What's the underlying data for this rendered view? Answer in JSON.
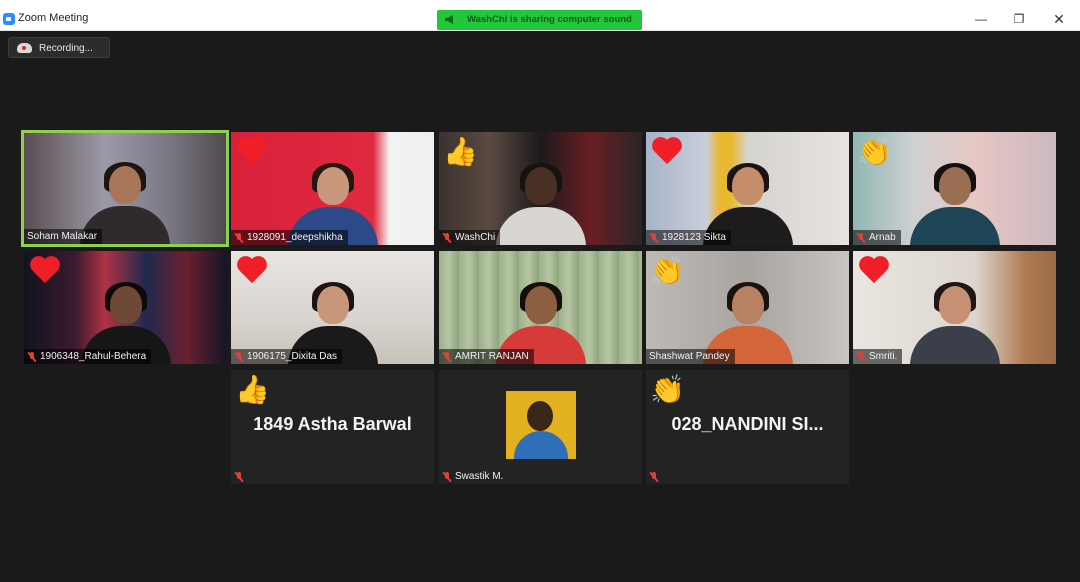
{
  "window": {
    "title": "Zoom Meeting",
    "minimize_glyph": "—",
    "maximize_glyph": "❐",
    "close_glyph": "✕"
  },
  "share_banner": {
    "text": "WashChi is sharing computer sound",
    "color": "#22c63a"
  },
  "recording": {
    "label": "Recording..."
  },
  "colors": {
    "active_speaker_border": "#8fd14f",
    "mute_icon": "#e0403a",
    "heart": "#ef1e27"
  },
  "participants": [
    {
      "name": "Soham Malakar",
      "muted": false,
      "active_speaker": true,
      "reaction": ""
    },
    {
      "name": "1928091_deepshikha",
      "muted": true,
      "reaction": "heart"
    },
    {
      "name": "WashChi",
      "muted": true,
      "reaction": "thumbs-up",
      "reaction_glyph": "👍"
    },
    {
      "name": "1928123 Sikta",
      "muted": true,
      "reaction": "heart"
    },
    {
      "name": "Arnab",
      "muted": true,
      "reaction": "clap",
      "reaction_glyph": "👏"
    },
    {
      "name": "1906348_Rahul-Behera",
      "muted": true,
      "reaction": "heart"
    },
    {
      "name": "1906175_Dixita Das",
      "muted": true,
      "reaction": "heart"
    },
    {
      "name": "AMRIT RANJAN",
      "muted": true,
      "reaction": ""
    },
    {
      "name": "Shashwat Pandey",
      "muted": false,
      "reaction": "clap",
      "reaction_glyph": "👏"
    },
    {
      "name": "Smriti.",
      "muted": true,
      "reaction": "heart"
    },
    {
      "name": "",
      "display_name": "1849 Astha Barwal",
      "muted": true,
      "reaction": "thumbs-up",
      "reaction_glyph": "👍",
      "video_off": true
    },
    {
      "name": "Swastik M.",
      "muted": true,
      "reaction": "",
      "video_off": true,
      "has_avatar": true
    },
    {
      "name": "",
      "display_name": "028_NANDINI  SI...",
      "muted": true,
      "reaction": "clap",
      "reaction_glyph": "👏",
      "video_off": true
    }
  ]
}
